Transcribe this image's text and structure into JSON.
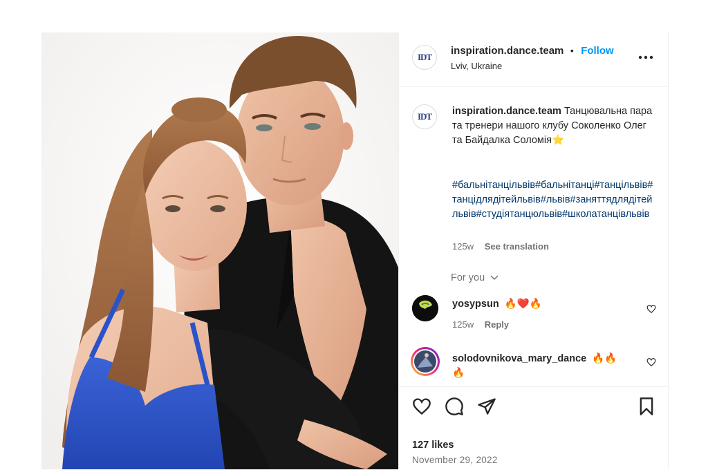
{
  "post": {
    "username": "inspiration.dance.team",
    "follow_label": "Follow",
    "separator": "•",
    "location": "Lviv, Ukraine",
    "avatar_logo": "IDT",
    "caption_text": "Танцювальна пара та тренери нашого клубу Соколенко Олег та Байдалка Соломія⭐",
    "hashtags": "#бальнітанцільвів#бальнітанці#танцільвів#танцідлядітейльвів#львів#заняттядлядітейльвів#студіятанцюльвів#школатанцівльвів",
    "caption_age": "125w",
    "see_translation": "See translation",
    "for_you_label": "For you",
    "likes": "127 likes",
    "date": "November 29, 2022"
  },
  "comments": [
    {
      "username": "yosypsun",
      "text": "🔥❤️🔥",
      "age": "125w",
      "reply_label": "Reply",
      "avatar_icon": "green-yellow-avatar"
    },
    {
      "username": "solodovnikova_mary_dance",
      "text": "🔥🔥",
      "text_cont": "🔥",
      "avatar_icon": "dancer-photo-avatar"
    }
  ],
  "icons": {
    "more": "more-options-icon",
    "like": "heart-icon",
    "comment": "comment-bubble-icon",
    "share": "paper-plane-icon",
    "save": "bookmark-icon",
    "chevron": "chevron-down-icon"
  },
  "colors": {
    "accent": "#0095f6",
    "hashtag": "#00376b",
    "muted": "#737373",
    "dress": "#2a52c9"
  }
}
